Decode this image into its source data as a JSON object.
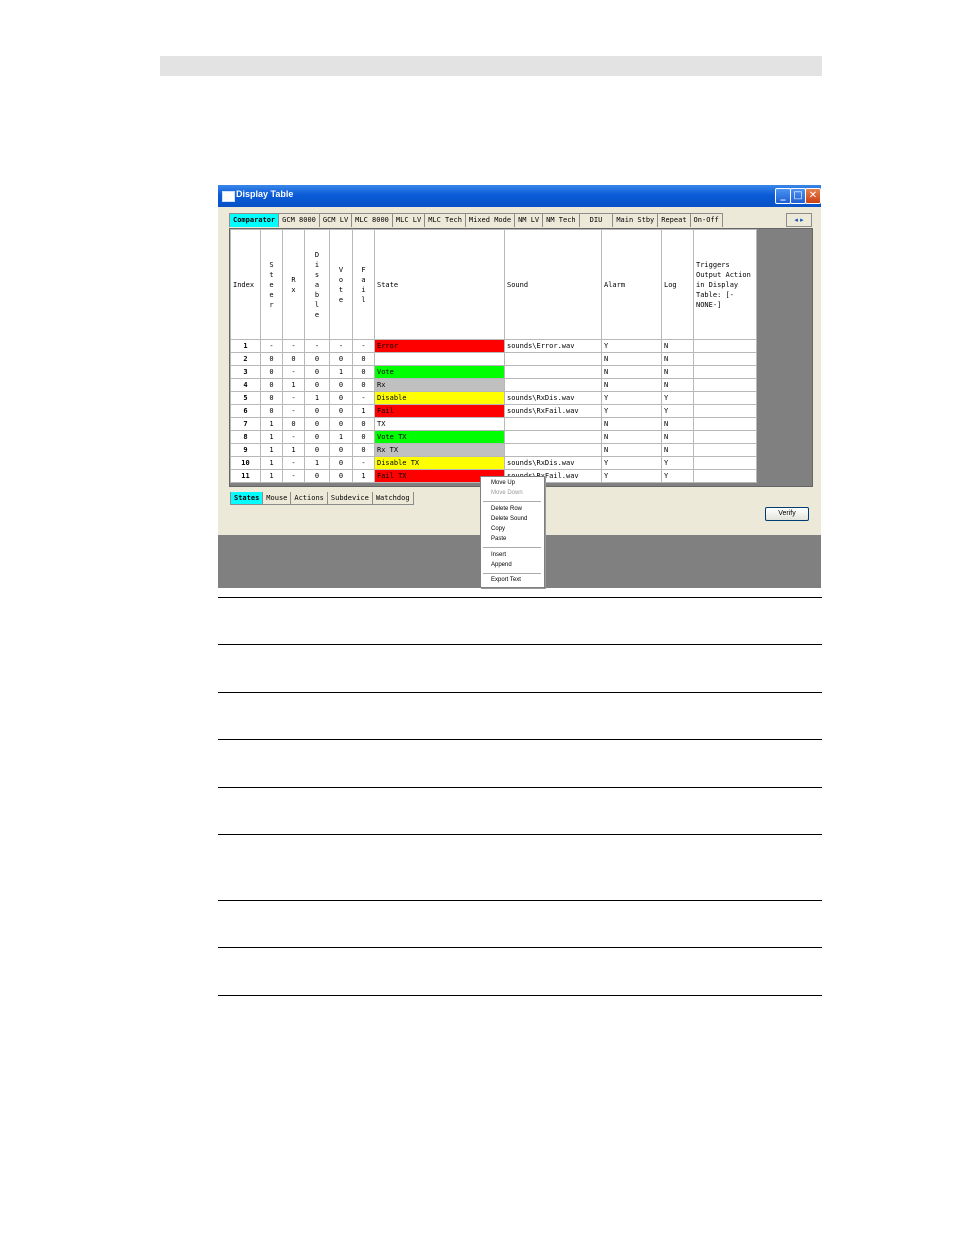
{
  "window": {
    "title": "Display Table"
  },
  "top_tabs": [
    "Comparator",
    "GCM 8000",
    "GCM LV",
    "MLC 8000",
    "MLC LV",
    "MLC Tech",
    "Mixed Mode",
    "NM LV",
    "NM Tech",
    "DIU",
    "Main Stby",
    "Repeat",
    "On-Off"
  ],
  "top_tab_arrows": "◂ ▸",
  "columns": {
    "index": "Index",
    "steer": "Steer",
    "rx": "Rx",
    "disable": "Disable",
    "vote": "Vote",
    "fail": "Fail",
    "state": "State",
    "sound": "Sound",
    "alarm": "Alarm",
    "log": "Log",
    "triggers": "Triggers Output Action in Display Table: [-NONE-]"
  },
  "rows": [
    {
      "index": "1",
      "steer": "-",
      "rx": "-",
      "disable": "-",
      "vote": "-",
      "fail": "-",
      "state": "Error",
      "sound": "sounds\\Error.wav",
      "alarm": "Y",
      "log": "N",
      "state_color": "#ff0000"
    },
    {
      "index": "2",
      "steer": "0",
      "rx": "0",
      "disable": "0",
      "vote": "0",
      "fail": "0",
      "state": "",
      "sound": "",
      "alarm": "N",
      "log": "N",
      "state_color": ""
    },
    {
      "index": "3",
      "steer": "0",
      "rx": "-",
      "disable": "0",
      "vote": "1",
      "fail": "0",
      "state": "Vote",
      "sound": "",
      "alarm": "N",
      "log": "N",
      "state_color": "#00ff00"
    },
    {
      "index": "4",
      "steer": "0",
      "rx": "1",
      "disable": "0",
      "vote": "0",
      "fail": "0",
      "state": "Rx",
      "sound": "",
      "alarm": "N",
      "log": "N",
      "state_color": "#c0c0c0"
    },
    {
      "index": "5",
      "steer": "0",
      "rx": "-",
      "disable": "1",
      "vote": "0",
      "fail": "-",
      "state": "Disable",
      "sound": "sounds\\RxDis.wav",
      "alarm": "Y",
      "log": "Y",
      "state_color": "#ffff00"
    },
    {
      "index": "6",
      "steer": "0",
      "rx": "-",
      "disable": "0",
      "vote": "0",
      "fail": "1",
      "state": "Fail",
      "sound": "sounds\\RxFail.wav",
      "alarm": "Y",
      "log": "Y",
      "state_color": "#ff0000"
    },
    {
      "index": "7",
      "steer": "1",
      "rx": "0",
      "disable": "0",
      "vote": "0",
      "fail": "0",
      "state": "TX",
      "sound": "",
      "alarm": "N",
      "log": "N",
      "state_color": ""
    },
    {
      "index": "8",
      "steer": "1",
      "rx": "-",
      "disable": "0",
      "vote": "1",
      "fail": "0",
      "state": "Vote TX",
      "sound": "",
      "alarm": "N",
      "log": "N",
      "state_color": "#00ff00"
    },
    {
      "index": "9",
      "steer": "1",
      "rx": "1",
      "disable": "0",
      "vote": "0",
      "fail": "0",
      "state": "Rx TX",
      "sound": "",
      "alarm": "N",
      "log": "N",
      "state_color": "#c0c0c0"
    },
    {
      "index": "10",
      "steer": "1",
      "rx": "-",
      "disable": "1",
      "vote": "0",
      "fail": "-",
      "state": "Disable TX",
      "sound": "sounds\\RxDis.wav",
      "alarm": "Y",
      "log": "Y",
      "state_color": "#ffff00"
    },
    {
      "index": "11",
      "steer": "1",
      "rx": "-",
      "disable": "0",
      "vote": "0",
      "fail": "1",
      "state": "Fail TX",
      "sound": "sounds\\RxFail.wav",
      "alarm": "Y",
      "log": "Y",
      "state_color": "#ff0000"
    }
  ],
  "bottom_tabs": [
    "States",
    "Mouse",
    "Actions",
    "Subdevice",
    "Watchdog"
  ],
  "verify_label": "Verify",
  "context_menu": {
    "move_up": "Move Up",
    "move_down": "Move Down",
    "delete_row": "Delete Row",
    "delete_sound": "Delete Sound",
    "copy": "Copy",
    "paste": "Paste",
    "insert": "Insert",
    "append": "Append",
    "export_text": "Export Text"
  },
  "colors": {
    "active_tab": "#00ffff",
    "titlebar": "#0a5bd8"
  }
}
